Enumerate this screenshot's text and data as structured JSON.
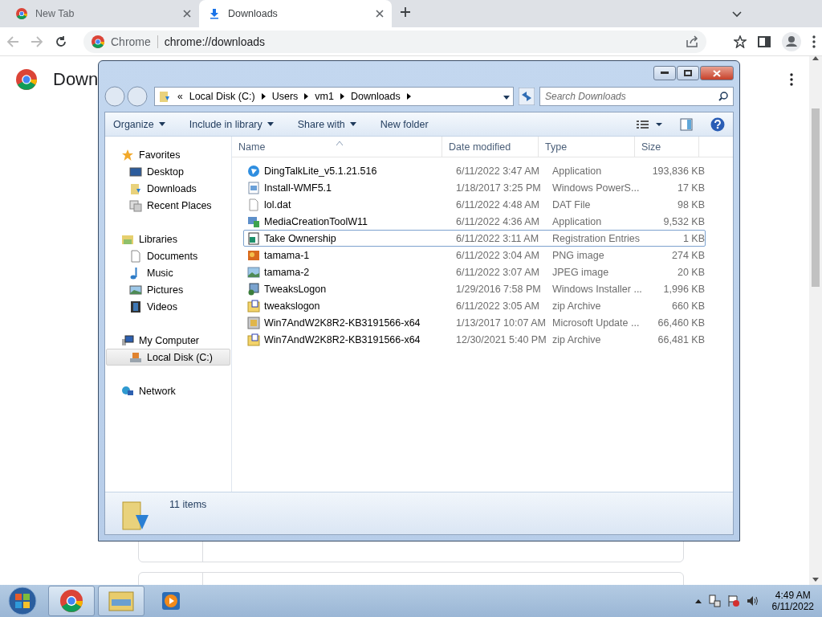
{
  "browser": {
    "tabs": [
      {
        "title": "New Tab",
        "kind": "newtab",
        "selected": false
      },
      {
        "title": "Downloads",
        "kind": "downloads",
        "selected": true
      }
    ],
    "omnibox": {
      "site_label": "Chrome",
      "url": "chrome://downloads"
    }
  },
  "page": {
    "heading": "Down"
  },
  "explorer": {
    "overflow": "«",
    "breadcrumb": [
      "Local Disk (C:)",
      "Users",
      "vm1",
      "Downloads"
    ],
    "search": {
      "placeholder": "Search Downloads"
    },
    "commands": [
      "Organize",
      "Include in library",
      "Share with",
      "New folder"
    ],
    "nav": [
      {
        "label": "Favorites",
        "kind": "favorites",
        "selected": false,
        "children": [
          {
            "label": "Desktop",
            "kind": "desktop",
            "selected": false
          },
          {
            "label": "Downloads",
            "kind": "downloads",
            "selected": false
          },
          {
            "label": "Recent Places",
            "kind": "recent",
            "selected": false
          }
        ]
      },
      {
        "label": "Libraries",
        "kind": "libraries",
        "selected": false,
        "children": [
          {
            "label": "Documents",
            "kind": "documents",
            "selected": false
          },
          {
            "label": "Music",
            "kind": "music",
            "selected": false
          },
          {
            "label": "Pictures",
            "kind": "pictures",
            "selected": false
          },
          {
            "label": "Videos",
            "kind": "videos",
            "selected": false
          }
        ]
      },
      {
        "label": "My Computer",
        "kind": "computer",
        "selected": false,
        "children": [
          {
            "label": "Local Disk (C:)",
            "kind": "disk",
            "selected": true
          }
        ]
      },
      {
        "label": "Network",
        "kind": "network",
        "selected": false
      }
    ],
    "columns": [
      "Name",
      "Date modified",
      "Type",
      "Size"
    ],
    "files": [
      {
        "name": "DingTalkLite_v5.1.21.516",
        "date": "6/11/2022 3:47 AM",
        "type": "Application",
        "size": "193,836 KB",
        "kind": "app",
        "focused": false
      },
      {
        "name": "Install-WMF5.1",
        "date": "1/18/2017 3:25 PM",
        "type": "Windows PowerS...",
        "size": "17 KB",
        "kind": "script",
        "focused": false
      },
      {
        "name": "lol.dat",
        "date": "6/11/2022 4:48 AM",
        "type": "DAT File",
        "size": "98 KB",
        "kind": "blank",
        "focused": false
      },
      {
        "name": "MediaCreationToolW11",
        "date": "6/11/2022 4:36 AM",
        "type": "Application",
        "size": "9,532 KB",
        "kind": "setup",
        "focused": false
      },
      {
        "name": "Take Ownership",
        "date": "6/11/2022 3:11 AM",
        "type": "Registration Entries",
        "size": "1 KB",
        "kind": "reg",
        "focused": true
      },
      {
        "name": "tamama-1",
        "date": "6/11/2022 3:04 AM",
        "type": "PNG image",
        "size": "274 KB",
        "kind": "png",
        "focused": false
      },
      {
        "name": "tamama-2",
        "date": "6/11/2022 3:07 AM",
        "type": "JPEG image",
        "size": "20 KB",
        "kind": "jpg",
        "focused": false
      },
      {
        "name": "TweaksLogon",
        "date": "1/29/2016 7:58 PM",
        "type": "Windows Installer ...",
        "size": "1,996 KB",
        "kind": "msi",
        "focused": false
      },
      {
        "name": "tweakslogon",
        "date": "6/11/2022 3:05 AM",
        "type": "zip Archive",
        "size": "660 KB",
        "kind": "zip",
        "focused": false
      },
      {
        "name": "Win7AndW2K8R2-KB3191566-x64",
        "date": "1/13/2017 10:07 AM",
        "type": "Microsoft Update ...",
        "size": "66,460 KB",
        "kind": "update",
        "focused": false
      },
      {
        "name": "Win7AndW2K8R2-KB3191566-x64",
        "date": "12/30/2021 5:40 PM",
        "type": "zip Archive",
        "size": "66,481 KB",
        "kind": "zip",
        "focused": false
      }
    ],
    "status": "11 items"
  },
  "taskbar": {
    "apps": [
      {
        "kind": "chrome",
        "active": true
      },
      {
        "kind": "explorer",
        "active": true
      },
      {
        "kind": "media",
        "active": false
      }
    ],
    "time": "4:49 AM",
    "date": "6/11/2022"
  }
}
